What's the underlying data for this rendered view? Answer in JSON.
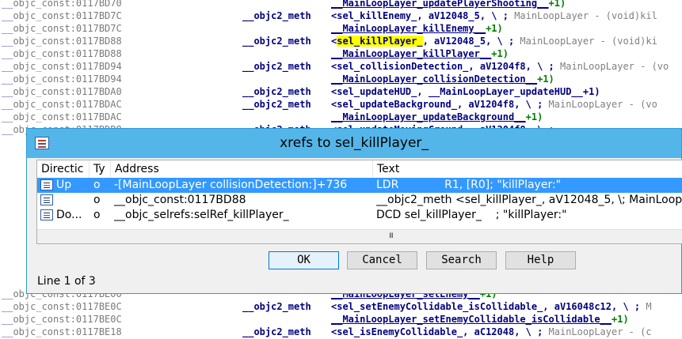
{
  "listing": {
    "lines": [
      {
        "addr_pre": "__",
        "addr": "objc_const:0117BD70",
        "sub": "__MainLoopLayer_updatePlayerShooting__",
        "num": "+1)"
      },
      {
        "addr_pre": "__",
        "addr": "objc_const:0117BD7C",
        "mnem": "__objc2_meth",
        "operand": "<sel_killEnemy_, aV12048_5, \\ ;",
        "comment": " MainLoopLayer - (void)kil"
      },
      {
        "addr_pre": "__",
        "addr": "objc_const:0117BD7C",
        "sub": "__MainLoopLayer_killEnemy__",
        "num": "+1)"
      },
      {
        "addr_pre": "__",
        "addr": "objc_const:0117BD88",
        "mnem": "__objc2_meth",
        "operand_pre": "<",
        "highlight": "sel_killPlayer_",
        "operand": ", aV12048_5, \\ ;",
        "comment": " MainLoopLayer - (void)ki"
      },
      {
        "addr_pre": "__",
        "addr": "objc_const:0117BD88",
        "sub": "__MainLoopLayer_killPlayer__",
        "num": "+1)"
      },
      {
        "addr_pre": "__",
        "addr": "objc_const:0117BD94",
        "mnem": "__objc2_meth",
        "operand": "<sel_collisionDetection_, aV1204f8, \\ ;",
        "comment": " MainLoopLayer - (vo"
      },
      {
        "addr_pre": "__",
        "addr": "objc_const:0117BD94",
        "sub": "__MainLoopLayer_collisionDetection__",
        "num": "+1)"
      },
      {
        "addr_pre": "__",
        "addr": "objc_const:0117BDA0",
        "mnem": "__objc2_meth",
        "operand": "<sel_updateHUD_, __MainLoopLayer_updateHUD__+1)",
        "comment": ""
      },
      {
        "addr_pre": "__",
        "addr": "objc_const:0117BDAC",
        "mnem": "__objc2_meth",
        "operand": "<sel_updateBackground_, aV1204f8, \\ ;",
        "comment": " MainLoopLayer - (vo"
      },
      {
        "addr_pre": "__",
        "addr": "objc_const:0117BDAC",
        "sub": "__MainLoopLayer_updateBackground__",
        "num": "+1)"
      },
      {
        "addr_pre": "__",
        "addr": "objc_const:0117BDB8",
        "mnem": "__objc2_meth",
        "operand": "<sel_updateMovingGround_, aV1204f8, \\ ;",
        "comment": ""
      },
      {
        "addr_pre": "__",
        "addr": "objc_const:0117BE00",
        "sub": "__MainLoopLayer_setEnemy__",
        "num": "+1)"
      },
      {
        "addr_pre": "__",
        "addr": "objc_const:0117BE0C",
        "mnem": "__objc2_meth",
        "operand": "<sel_setEnemyCollidable_isCollidable_, aV16048c12, \\ ;",
        "comment": " M"
      },
      {
        "addr_pre": "__",
        "addr": "objc_const:0117BE0C",
        "sub": "__MainLoopLayer_setEnemyCollidable_isCollidable__",
        "num": "+1)"
      },
      {
        "addr_pre": "__",
        "addr": "objc_const:0117BE18",
        "mnem": "__objc2_meth",
        "operand": "<sel_isEnemyCollidable_, aC12048, \\ ;",
        "comment": " MainLoopLayer - (c"
      }
    ]
  },
  "dialog": {
    "title": "xrefs to sel_killPlayer_",
    "columns": [
      "Directic",
      "Ty",
      "Address",
      "Text"
    ],
    "rows": [
      {
        "direction": "Up",
        "type": "o",
        "address": "-[MainLoopLayer collisionDetection:]+736",
        "text": "LDR             R1, [R0]; \"killPlayer:\"",
        "selected": true
      },
      {
        "direction": "",
        "type": "o",
        "address": "__objc_const:0117BD88",
        "text": "__objc2_meth <sel_killPlayer_, aV12048_5, \\; MainLoop"
      },
      {
        "direction": "Do...",
        "type": "o",
        "address": "__objc_selrefs:selRef_killPlayer_",
        "text": "DCD sel_killPlayer_    ; \"killPlayer:\""
      }
    ],
    "scroll_glyph": "III",
    "buttons": {
      "ok": "OK",
      "cancel": "Cancel",
      "search": "Search",
      "help": "Help"
    },
    "status": "Line 1 of 3"
  }
}
